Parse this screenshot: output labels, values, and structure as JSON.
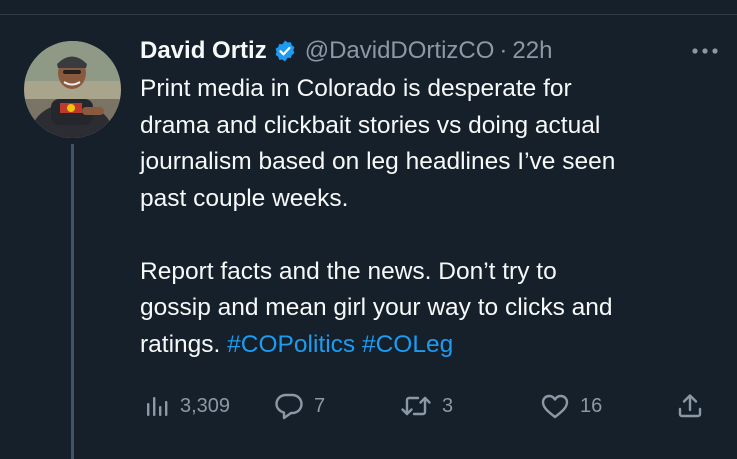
{
  "tweet": {
    "author_name": "David Ortiz",
    "handle": "@DavidDOrtizCO",
    "separator": "·",
    "time": "22h",
    "body": {
      "line1": "Print media in Colorado is desperate for",
      "line2": "drama and clickbait stories vs doing actual",
      "line3": "journalism based on leg headlines I’ve seen",
      "line4": "past couple weeks.",
      "line5": "Report facts and the news. Don’t try to",
      "line6": "gossip and mean girl your way to clicks and",
      "line7_text": "ratings. ",
      "hashtag1": "#COPolitics",
      "hashtag_space": " ",
      "hashtag2": "#COLeg"
    }
  },
  "actions": {
    "views": "3,309",
    "replies": "7",
    "retweets": "3",
    "likes": "16"
  },
  "icons": {
    "verified": "verified-badge-icon",
    "more": "more-dots-icon",
    "views": "analytics-icon",
    "reply": "reply-icon",
    "retweet": "retweet-icon",
    "like": "heart-icon",
    "share": "share-icon"
  },
  "colors": {
    "background": "#15202b",
    "text": "#f7f9f9",
    "muted": "#8b98a5",
    "accent": "#1d9bf0"
  }
}
